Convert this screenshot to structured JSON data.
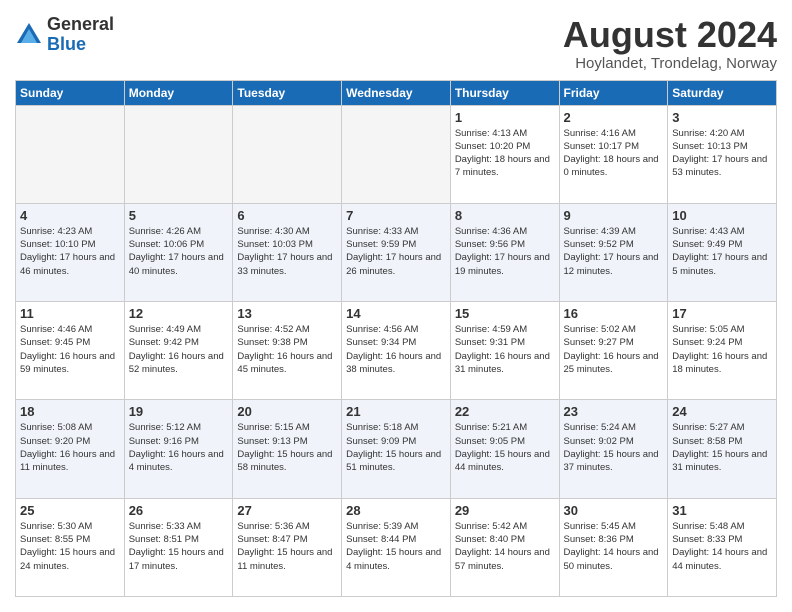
{
  "logo": {
    "general": "General",
    "blue": "Blue"
  },
  "title": "August 2024",
  "subtitle": "Hoylandet, Trondelag, Norway",
  "weekdays": [
    "Sunday",
    "Monday",
    "Tuesday",
    "Wednesday",
    "Thursday",
    "Friday",
    "Saturday"
  ],
  "weeks": [
    [
      {
        "day": "",
        "empty": true
      },
      {
        "day": "",
        "empty": true
      },
      {
        "day": "",
        "empty": true
      },
      {
        "day": "",
        "empty": true
      },
      {
        "day": "1",
        "sunrise": "4:13 AM",
        "sunset": "10:20 PM",
        "daylight": "18 hours and 7 minutes."
      },
      {
        "day": "2",
        "sunrise": "4:16 AM",
        "sunset": "10:17 PM",
        "daylight": "18 hours and 0 minutes."
      },
      {
        "day": "3",
        "sunrise": "4:20 AM",
        "sunset": "10:13 PM",
        "daylight": "17 hours and 53 minutes."
      }
    ],
    [
      {
        "day": "4",
        "sunrise": "4:23 AM",
        "sunset": "10:10 PM",
        "daylight": "17 hours and 46 minutes."
      },
      {
        "day": "5",
        "sunrise": "4:26 AM",
        "sunset": "10:06 PM",
        "daylight": "17 hours and 40 minutes."
      },
      {
        "day": "6",
        "sunrise": "4:30 AM",
        "sunset": "10:03 PM",
        "daylight": "17 hours and 33 minutes."
      },
      {
        "day": "7",
        "sunrise": "4:33 AM",
        "sunset": "9:59 PM",
        "daylight": "17 hours and 26 minutes."
      },
      {
        "day": "8",
        "sunrise": "4:36 AM",
        "sunset": "9:56 PM",
        "daylight": "17 hours and 19 minutes."
      },
      {
        "day": "9",
        "sunrise": "4:39 AM",
        "sunset": "9:52 PM",
        "daylight": "17 hours and 12 minutes."
      },
      {
        "day": "10",
        "sunrise": "4:43 AM",
        "sunset": "9:49 PM",
        "daylight": "17 hours and 5 minutes."
      }
    ],
    [
      {
        "day": "11",
        "sunrise": "4:46 AM",
        "sunset": "9:45 PM",
        "daylight": "16 hours and 59 minutes."
      },
      {
        "day": "12",
        "sunrise": "4:49 AM",
        "sunset": "9:42 PM",
        "daylight": "16 hours and 52 minutes."
      },
      {
        "day": "13",
        "sunrise": "4:52 AM",
        "sunset": "9:38 PM",
        "daylight": "16 hours and 45 minutes."
      },
      {
        "day": "14",
        "sunrise": "4:56 AM",
        "sunset": "9:34 PM",
        "daylight": "16 hours and 38 minutes."
      },
      {
        "day": "15",
        "sunrise": "4:59 AM",
        "sunset": "9:31 PM",
        "daylight": "16 hours and 31 minutes."
      },
      {
        "day": "16",
        "sunrise": "5:02 AM",
        "sunset": "9:27 PM",
        "daylight": "16 hours and 25 minutes."
      },
      {
        "day": "17",
        "sunrise": "5:05 AM",
        "sunset": "9:24 PM",
        "daylight": "16 hours and 18 minutes."
      }
    ],
    [
      {
        "day": "18",
        "sunrise": "5:08 AM",
        "sunset": "9:20 PM",
        "daylight": "16 hours and 11 minutes."
      },
      {
        "day": "19",
        "sunrise": "5:12 AM",
        "sunset": "9:16 PM",
        "daylight": "16 hours and 4 minutes."
      },
      {
        "day": "20",
        "sunrise": "5:15 AM",
        "sunset": "9:13 PM",
        "daylight": "15 hours and 58 minutes."
      },
      {
        "day": "21",
        "sunrise": "5:18 AM",
        "sunset": "9:09 PM",
        "daylight": "15 hours and 51 minutes."
      },
      {
        "day": "22",
        "sunrise": "5:21 AM",
        "sunset": "9:05 PM",
        "daylight": "15 hours and 44 minutes."
      },
      {
        "day": "23",
        "sunrise": "5:24 AM",
        "sunset": "9:02 PM",
        "daylight": "15 hours and 37 minutes."
      },
      {
        "day": "24",
        "sunrise": "5:27 AM",
        "sunset": "8:58 PM",
        "daylight": "15 hours and 31 minutes."
      }
    ],
    [
      {
        "day": "25",
        "sunrise": "5:30 AM",
        "sunset": "8:55 PM",
        "daylight": "15 hours and 24 minutes."
      },
      {
        "day": "26",
        "sunrise": "5:33 AM",
        "sunset": "8:51 PM",
        "daylight": "15 hours and 17 minutes."
      },
      {
        "day": "27",
        "sunrise": "5:36 AM",
        "sunset": "8:47 PM",
        "daylight": "15 hours and 11 minutes."
      },
      {
        "day": "28",
        "sunrise": "5:39 AM",
        "sunset": "8:44 PM",
        "daylight": "15 hours and 4 minutes."
      },
      {
        "day": "29",
        "sunrise": "5:42 AM",
        "sunset": "8:40 PM",
        "daylight": "14 hours and 57 minutes."
      },
      {
        "day": "30",
        "sunrise": "5:45 AM",
        "sunset": "8:36 PM",
        "daylight": "14 hours and 50 minutes."
      },
      {
        "day": "31",
        "sunrise": "5:48 AM",
        "sunset": "8:33 PM",
        "daylight": "14 hours and 44 minutes."
      }
    ]
  ],
  "labels": {
    "sunrise": "Sunrise:",
    "sunset": "Sunset:",
    "daylight": "Daylight hours"
  }
}
